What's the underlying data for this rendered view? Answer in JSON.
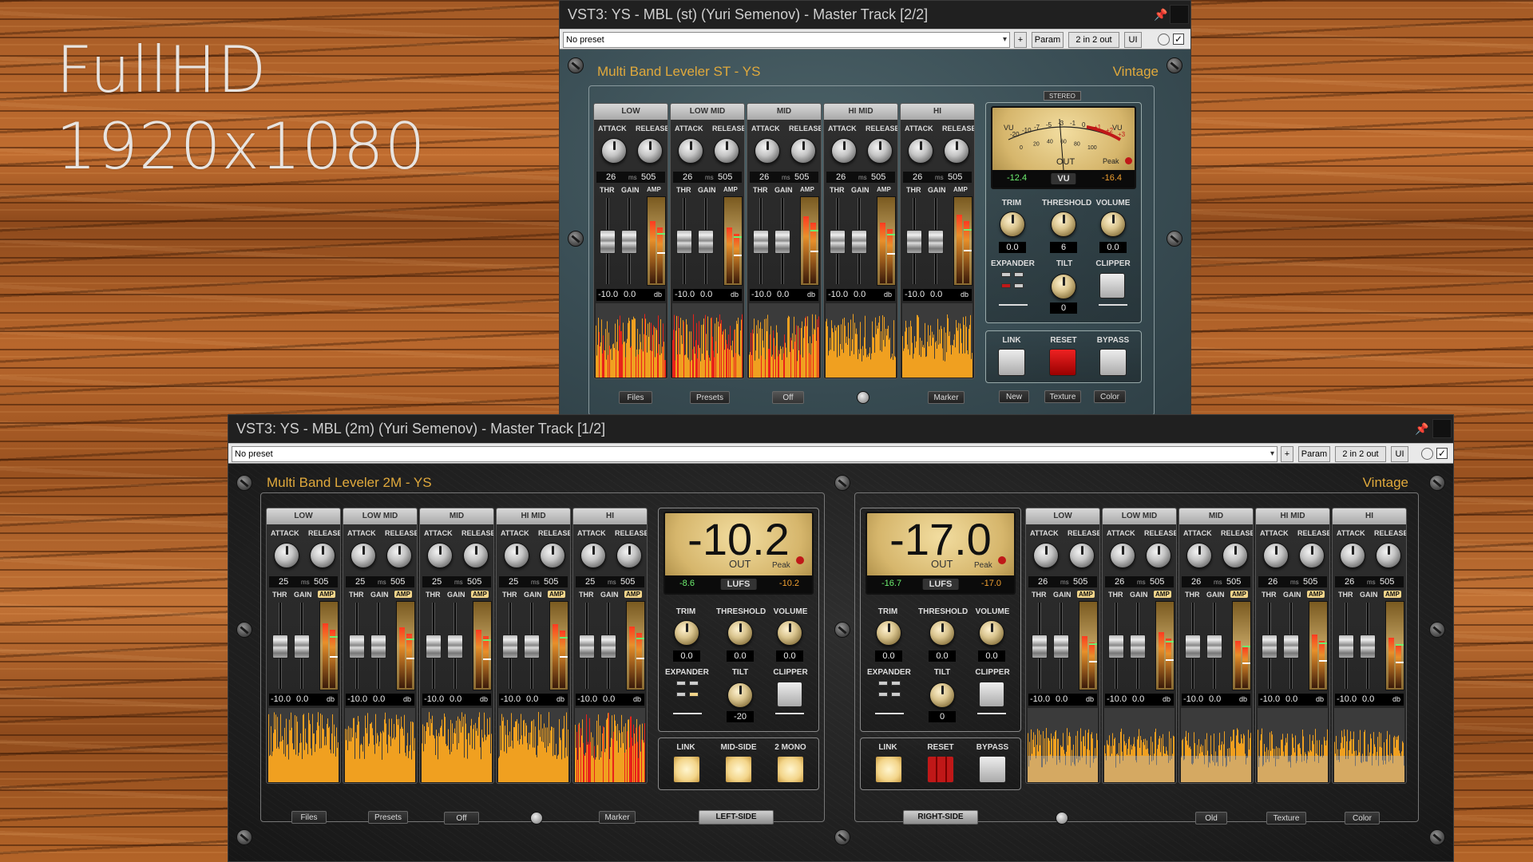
{
  "background_caption": {
    "line1": "FullHD",
    "line2": "1920x1080"
  },
  "colors": {
    "accent": "#e0a93c",
    "panel_teal": "#3f545a",
    "panel_dark": "#1e1e1e",
    "reset_red": "#c01818",
    "lit_button": "#f3d58a"
  },
  "window_st": {
    "title": "VST3: YS - MBL (st) (Yuri Semenov) - Master Track [2/2]",
    "preset": "No preset",
    "btn_plus": "+",
    "btn_param": "Param",
    "btn_io": "2 in 2 out",
    "btn_ui": "UI",
    "checkbox": "✓",
    "plugin_title": "Multi Band Leveler ST - YS",
    "skin": "Vintage",
    "bands": [
      {
        "name": "LOW",
        "attack": "26",
        "release": "505",
        "thr": "-10.0",
        "gain": "0.0",
        "meter_level": 0.72
      },
      {
        "name": "LOW MID",
        "attack": "26",
        "release": "505",
        "thr": "-10.0",
        "gain": "0.0",
        "meter_level": 0.65
      },
      {
        "name": "MID",
        "attack": "26",
        "release": "505",
        "thr": "-10.0",
        "gain": "0.0",
        "meter_level": 0.78
      },
      {
        "name": "HI MID",
        "attack": "26",
        "release": "505",
        "thr": "-10.0",
        "gain": "0.0",
        "meter_level": 0.7
      },
      {
        "name": "HI",
        "attack": "26",
        "release": "505",
        "thr": "-10.0",
        "gain": "0.0",
        "meter_level": 0.8
      }
    ],
    "labels": {
      "attack": "ATTACK",
      "release": "RELEASE",
      "ms": "ms",
      "thr": "THR",
      "gain": "GAIN",
      "amp": "AMP",
      "db": "db"
    },
    "meter": {
      "mode_tag": "STEREO",
      "scale": [
        "-20",
        "-10",
        "-7",
        "-5",
        "-3",
        "-1",
        "0",
        "+1",
        "+2",
        "+3"
      ],
      "scale_low": [
        "0",
        "20",
        "40",
        "60",
        "80",
        "100"
      ],
      "vu": "VU",
      "out": "OUT",
      "peak": "Peak",
      "left": "-12.4",
      "right": "-16.4"
    },
    "controls": {
      "trim_label": "TRIM",
      "threshold_label": "THRESHOLD",
      "volume_label": "VOLUME",
      "trim": "0.0",
      "threshold": "6",
      "volume": "0.0",
      "expander_label": "EXPANDER",
      "tilt_label": "TILT",
      "clipper_label": "CLIPPER",
      "tilt": "0"
    },
    "buttons": {
      "link": "LINK",
      "reset": "RESET",
      "bypass": "BYPASS"
    },
    "footer": {
      "files": "Files",
      "presets": "Presets",
      "off": "Off",
      "marker": "Marker",
      "new": "New",
      "texture": "Texture",
      "color": "Color"
    }
  },
  "window_2m": {
    "title": "VST3: YS - MBL (2m) (Yuri Semenov) - Master Track [1/2]",
    "preset": "No preset",
    "btn_plus": "+",
    "btn_param": "Param",
    "btn_io": "2 in 2 out",
    "btn_ui": "UI",
    "checkbox": "✓",
    "plugin_title": "Multi Band Leveler 2M - YS",
    "skin": "Vintage",
    "left_bands": [
      {
        "name": "LOW",
        "attack": "25",
        "release": "505",
        "thr": "-10.0",
        "gain": "0.0",
        "meter_level": 0.75
      },
      {
        "name": "LOW MID",
        "attack": "25",
        "release": "505",
        "thr": "-10.0",
        "gain": "0.0",
        "meter_level": 0.7
      },
      {
        "name": "MID",
        "attack": "25",
        "release": "505",
        "thr": "-10.0",
        "gain": "0.0",
        "meter_level": 0.68
      },
      {
        "name": "HI MID",
        "attack": "25",
        "release": "505",
        "thr": "-10.0",
        "gain": "0.0",
        "meter_level": 0.74
      },
      {
        "name": "HI",
        "attack": "25",
        "release": "505",
        "thr": "-10.0",
        "gain": "0.0",
        "meter_level": 0.71
      }
    ],
    "right_bands": [
      {
        "name": "LOW",
        "attack": "26",
        "release": "505",
        "thr": "-10.0",
        "gain": "0.0",
        "meter_level": 0.6
      },
      {
        "name": "LOW MID",
        "attack": "26",
        "release": "505",
        "thr": "-10.0",
        "gain": "0.0",
        "meter_level": 0.65
      },
      {
        "name": "MID",
        "attack": "26",
        "release": "505",
        "thr": "-10.0",
        "gain": "0.0",
        "meter_level": 0.55
      },
      {
        "name": "HI MID",
        "attack": "26",
        "release": "505",
        "thr": "-10.0",
        "gain": "0.0",
        "meter_level": 0.62
      },
      {
        "name": "HI",
        "attack": "26",
        "release": "505",
        "thr": "-10.0",
        "gain": "0.0",
        "meter_level": 0.58
      }
    ],
    "labels": {
      "attack": "ATTACK",
      "release": "RELEASE",
      "ms": "ms",
      "thr": "THR",
      "gain": "GAIN",
      "amp": "AMP",
      "db": "db"
    },
    "left_meter": {
      "big": "-10.2",
      "out": "OUT",
      "peak": "Peak",
      "mode": "LUFS",
      "left": "-8.6",
      "right": "-10.2"
    },
    "right_meter": {
      "big": "-17.0",
      "out": "OUT",
      "peak": "Peak",
      "mode": "LUFS",
      "left": "-16.7",
      "right": "-17.0"
    },
    "left_controls": {
      "trim_label": "TRIM",
      "threshold_label": "THRESHOLD",
      "volume_label": "VOLUME",
      "trim": "0.0",
      "threshold": "0.0",
      "volume": "0.0",
      "expander_label": "EXPANDER",
      "tilt_label": "TILT",
      "clipper_label": "CLIPPER",
      "tilt": "-20"
    },
    "right_controls": {
      "trim_label": "TRIM",
      "threshold_label": "THRESHOLD",
      "volume_label": "VOLUME",
      "trim": "0.0",
      "threshold": "0.0",
      "volume": "0.0",
      "expander_label": "EXPANDER",
      "tilt_label": "TILT",
      "clipper_label": "CLIPPER",
      "tilt": "0"
    },
    "left_buttons": {
      "link": "LINK",
      "midside": "MID-SIDE",
      "mono": "2 MONO"
    },
    "right_buttons": {
      "link": "LINK",
      "reset": "RESET",
      "bypass": "BYPASS"
    },
    "footer": {
      "files": "Files",
      "presets": "Presets",
      "off": "Off",
      "marker": "Marker",
      "left_side": "LEFT-SIDE",
      "right_side": "RIGHT-SIDE",
      "old": "Old",
      "texture": "Texture",
      "color": "Color"
    }
  }
}
